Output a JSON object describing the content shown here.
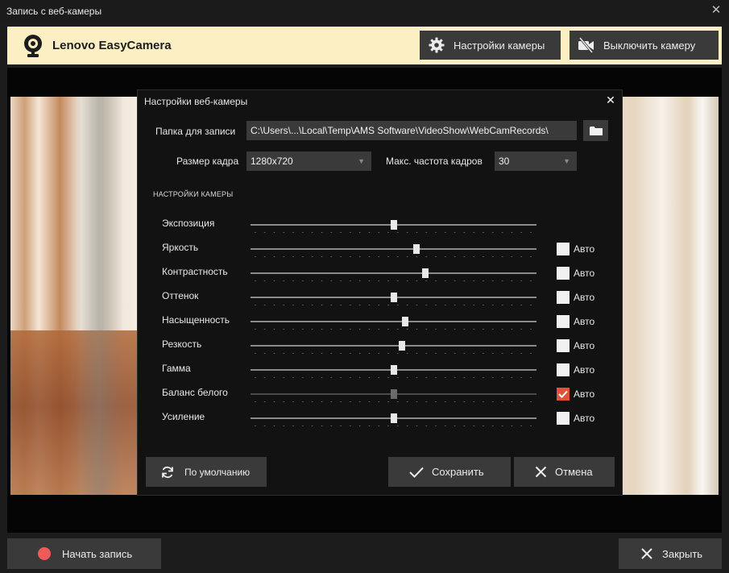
{
  "window": {
    "title": "Запись с веб-камеры",
    "close": "✕"
  },
  "brand": {
    "name": "Lenovo EasyCamera",
    "camera_settings_label": "Настройки камеры",
    "camera_off_label": "Выключить камеру"
  },
  "footer": {
    "record_label": "Начать запись",
    "close_label": "Закрыть"
  },
  "dialog": {
    "title": "Настройки веб-камеры",
    "close": "✕",
    "folder_label": "Папка для записи",
    "folder_value": "C:\\Users\\...\\Local\\Temp\\AMS Software\\VideoShow\\WebCamRecords\\",
    "frame_size_label": "Размер кадра",
    "frame_size_value": "1280x720",
    "fps_label": "Макс. частота кадров",
    "fps_value": "30",
    "section_title": "НАСТРОЙКИ КАМЕРЫ",
    "auto_label": "Авто",
    "default_label": "По умолчанию",
    "save_label": "Сохранить",
    "cancel_label": "Отмена"
  },
  "camera_settings": [
    {
      "label": "Экспозиция",
      "value": 0.5,
      "has_auto": false,
      "auto": false,
      "enabled": true
    },
    {
      "label": "Яркость",
      "value": 0.58,
      "has_auto": true,
      "auto": false,
      "enabled": true
    },
    {
      "label": "Контрастность",
      "value": 0.61,
      "has_auto": true,
      "auto": false,
      "enabled": true
    },
    {
      "label": "Оттенок",
      "value": 0.5,
      "has_auto": true,
      "auto": false,
      "enabled": true
    },
    {
      "label": "Насыщенность",
      "value": 0.54,
      "has_auto": true,
      "auto": false,
      "enabled": true
    },
    {
      "label": "Резкость",
      "value": 0.53,
      "has_auto": true,
      "auto": false,
      "enabled": true
    },
    {
      "label": "Гамма",
      "value": 0.5,
      "has_auto": true,
      "auto": false,
      "enabled": true
    },
    {
      "label": "Баланс белого",
      "value": 0.5,
      "has_auto": true,
      "auto": true,
      "enabled": false
    },
    {
      "label": "Усиление",
      "value": 0.5,
      "has_auto": true,
      "auto": false,
      "enabled": true
    }
  ],
  "colors": {
    "accent_record": "#ef5a5a",
    "checkbox_checked": "#e2523b",
    "brand_bar": "#fdefc4"
  }
}
